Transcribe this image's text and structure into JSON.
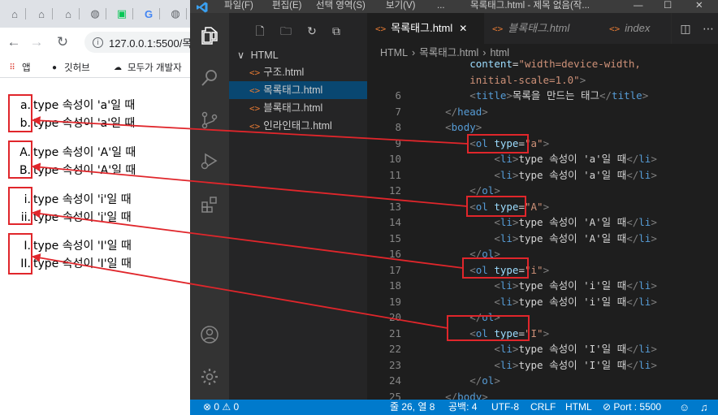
{
  "browser": {
    "tabs": [
      {
        "icon": "house-icon",
        "glyph": "⌂"
      },
      {
        "icon": "house-icon",
        "glyph": "⌂"
      },
      {
        "icon": "house-icon",
        "glyph": "⌂"
      },
      {
        "icon": "globe-icon",
        "glyph": "◍"
      },
      {
        "icon": "line-messenger-icon",
        "glyph": "▣"
      },
      {
        "icon": "google-icon",
        "glyph": "G"
      },
      {
        "icon": "globe-icon",
        "glyph": "◍"
      }
    ],
    "url": "127.0.0.1:5500/목",
    "bookmarks": [
      {
        "label": "앱",
        "icon": "apps-grid-icon"
      },
      {
        "label": "깃허브",
        "icon": "github-icon"
      },
      {
        "label": "모두가 개발자",
        "icon": "cloud-icon"
      }
    ],
    "lists": [
      {
        "items": [
          {
            "marker": "a.",
            "text": "type 속성이 'a'일 때"
          },
          {
            "marker": "b.",
            "text": "type 속성이 'a'일 때"
          }
        ]
      },
      {
        "items": [
          {
            "marker": "A.",
            "text": "type 속성이 'A'일 때"
          },
          {
            "marker": "B.",
            "text": "type 속성이 'A'일 때"
          }
        ]
      },
      {
        "items": [
          {
            "marker": "i.",
            "text": "type 속성이 'i'일 때"
          },
          {
            "marker": "ii.",
            "text": "type 속성이 'i'일 때"
          }
        ]
      },
      {
        "items": [
          {
            "marker": "I.",
            "text": "type 속성이 'I'일 때"
          },
          {
            "marker": "II.",
            "text": "type 속성이 'I'일 때"
          }
        ]
      }
    ]
  },
  "vscode": {
    "menu": [
      "파일(F)",
      "편집(E)",
      "선택 영역(S)",
      "보기(V)",
      "..."
    ],
    "window_title": "목록태그.html - 제목 없음(작...",
    "window_controls": [
      "—",
      "☐",
      "✕"
    ],
    "explorer": {
      "folder": "HTML",
      "files": [
        {
          "name": "구조.html",
          "selected": false
        },
        {
          "name": "목록태그.html",
          "selected": true
        },
        {
          "name": "블록태그.html",
          "selected": false
        },
        {
          "name": "인라인태그.html",
          "selected": false
        }
      ]
    },
    "tabs": [
      {
        "label": "목록태그.html",
        "active": true,
        "close": "✕"
      },
      {
        "label": "블록태그.html",
        "active": false
      },
      {
        "label": "index",
        "active": false
      }
    ],
    "breadcrumb": [
      "HTML",
      "›",
      "목록태그.html",
      "›",
      "html"
    ],
    "code_lines": [
      {
        "n": "",
        "html": "<span class='at'>content</span><span class='tt'>=</span><span class='sv'>\"width=device-width,</span>",
        "indent": "        "
      },
      {
        "n": "",
        "html": "<span class='sv'>initial-scale=1.0\"</span><span class='tg'>&gt;</span>",
        "indent": "        "
      },
      {
        "n": "6",
        "html": "<span class='tg'>&lt;</span><span class='tn'>title</span><span class='tg'>&gt;</span><span class='tt'>목록을 만드는 태그</span><span class='tg'>&lt;/</span><span class='tn'>title</span><span class='tg'>&gt;</span>",
        "indent": "        "
      },
      {
        "n": "7",
        "html": "<span class='tg'>&lt;/</span><span class='tn'>head</span><span class='tg'>&gt;</span>",
        "indent": "    "
      },
      {
        "n": "8",
        "html": "<span class='tg'>&lt;</span><span class='tn'>body</span><span class='tg'>&gt;</span>",
        "indent": "    "
      },
      {
        "n": "9",
        "html": "<span class='tg'>&lt;</span><span class='tn'>ol</span> <span class='at'>type</span><span class='tt'>=</span><span class='sv'>\"a\"</span><span class='tg'>&gt;</span>",
        "indent": "        "
      },
      {
        "n": "10",
        "html": "<span class='tg'>&lt;</span><span class='tn'>li</span><span class='tg'>&gt;</span><span class='tt'>type 속성이 'a'일 때</span><span class='tg'>&lt;/</span><span class='tn'>li</span><span class='tg'>&gt;</span>",
        "indent": "            "
      },
      {
        "n": "11",
        "html": "<span class='tg'>&lt;</span><span class='tn'>li</span><span class='tg'>&gt;</span><span class='tt'>type 속성이 'a'일 때</span><span class='tg'>&lt;/</span><span class='tn'>li</span><span class='tg'>&gt;</span>",
        "indent": "            "
      },
      {
        "n": "12",
        "html": "<span class='tg'>&lt;/</span><span class='tn'>ol</span><span class='tg'>&gt;</span>",
        "indent": "        "
      },
      {
        "n": "13",
        "html": "<span class='tg'>&lt;</span><span class='tn'>ol</span> <span class='at'>type</span><span class='tt'>=</span><span class='sv'>\"A\"</span><span class='tg'>&gt;</span>",
        "indent": "        "
      },
      {
        "n": "14",
        "html": "<span class='tg'>&lt;</span><span class='tn'>li</span><span class='tg'>&gt;</span><span class='tt'>type 속성이 'A'일 때</span><span class='tg'>&lt;/</span><span class='tn'>li</span><span class='tg'>&gt;</span>",
        "indent": "            "
      },
      {
        "n": "15",
        "html": "<span class='tg'>&lt;</span><span class='tn'>li</span><span class='tg'>&gt;</span><span class='tt'>type 속성이 'A'일 때</span><span class='tg'>&lt;/</span><span class='tn'>li</span><span class='tg'>&gt;</span>",
        "indent": "            "
      },
      {
        "n": "16",
        "html": "<span class='tg'>&lt;/</span><span class='tn'>ol</span><span class='tg'>&gt;</span>",
        "indent": "        "
      },
      {
        "n": "17",
        "html": "<span class='tg'>&lt;</span><span class='tn'>ol</span> <span class='at'>type</span><span class='tt'>=</span><span class='sv'>\"i\"</span><span class='tg'>&gt;</span>",
        "indent": "        "
      },
      {
        "n": "18",
        "html": "<span class='tg'>&lt;</span><span class='tn'>li</span><span class='tg'>&gt;</span><span class='tt'>type 속성이 'i'일 때</span><span class='tg'>&lt;/</span><span class='tn'>li</span><span class='tg'>&gt;</span>",
        "indent": "            "
      },
      {
        "n": "19",
        "html": "<span class='tg'>&lt;</span><span class='tn'>li</span><span class='tg'>&gt;</span><span class='tt'>type 속성이 'i'일 때</span><span class='tg'>&lt;/</span><span class='tn'>li</span><span class='tg'>&gt;</span>",
        "indent": "            "
      },
      {
        "n": "20",
        "html": "<span class='tg'>&lt;/</span><span class='tn'>ol</span><span class='tg'>&gt;</span>",
        "indent": "        "
      },
      {
        "n": "21",
        "html": "<span class='tg'>&lt;</span><span class='tn'>ol</span> <span class='at'>type</span><span class='tt'>=</span><span class='sv'>\"I\"</span><span class='tg'>&gt;</span>",
        "indent": "        "
      },
      {
        "n": "22",
        "html": "<span class='tg'>&lt;</span><span class='tn'>li</span><span class='tg'>&gt;</span><span class='tt'>type 속성이 'I'일 때</span><span class='tg'>&lt;/</span><span class='tn'>li</span><span class='tg'>&gt;</span>",
        "indent": "            "
      },
      {
        "n": "23",
        "html": "<span class='tg'>&lt;</span><span class='tn'>li</span><span class='tg'>&gt;</span><span class='tt'>type 속성이 'I'일 때</span><span class='tg'>&lt;/</span><span class='tn'>li</span><span class='tg'>&gt;</span>",
        "indent": "            "
      },
      {
        "n": "24",
        "html": "<span class='tg'>&lt;/</span><span class='tn'>ol</span><span class='tg'>&gt;</span>",
        "indent": "        "
      },
      {
        "n": "25",
        "html": "<span class='tg'>&lt;/</span><span class='tn'>body</span><span class='tg'>&gt;</span>",
        "indent": "    "
      }
    ],
    "status": {
      "problems": "⊗ 0 ⚠ 0",
      "position": "줄 26, 열 8",
      "spaces": "공백: 4",
      "encoding": "UTF-8",
      "eol": "CRLF",
      "language": "HTML",
      "port": "⊘ Port : 5500"
    }
  },
  "colors": {
    "annotation": "#e0262b",
    "vscode_blue": "#007acc"
  }
}
